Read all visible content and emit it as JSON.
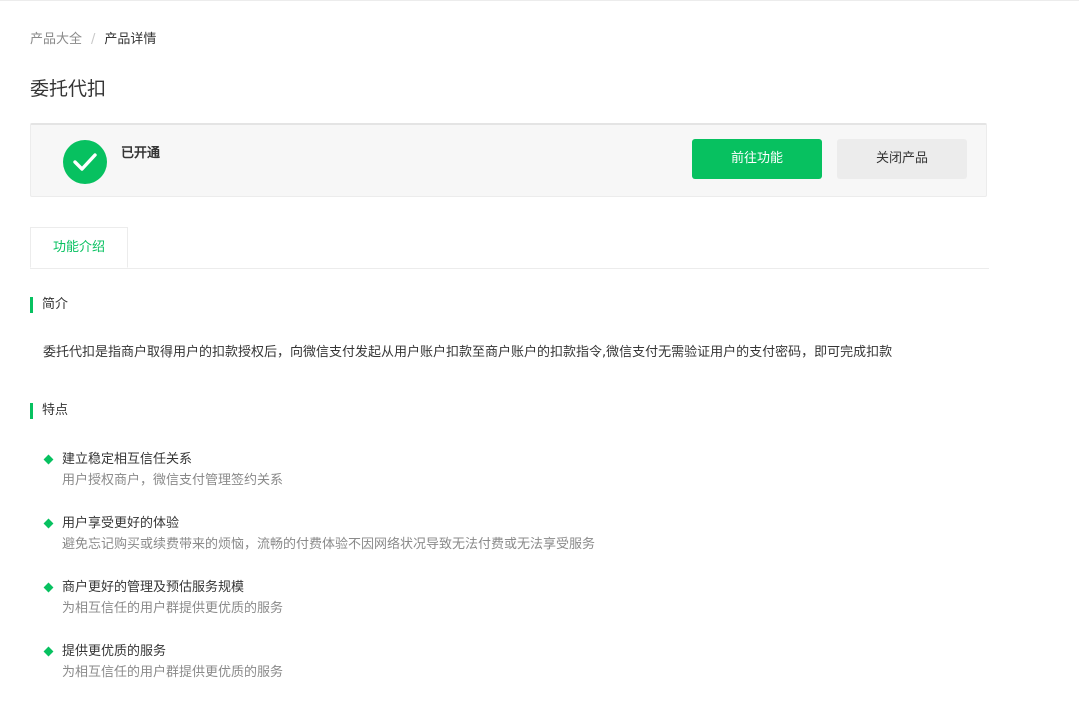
{
  "breadcrumb": {
    "parent": "产品大全",
    "separator": "/",
    "current": "产品详情"
  },
  "page": {
    "title": "委托代扣"
  },
  "status": {
    "label": "已开通",
    "primary_button": "前往功能",
    "secondary_button": "关闭产品",
    "icon": "check-circle-icon",
    "accent_color": "#07c160"
  },
  "tabs": [
    {
      "label": "功能介绍",
      "active": true
    }
  ],
  "sections": {
    "intro": {
      "title": "简介",
      "text": "委托代扣是指商户取得用户的扣款授权后，向微信支付发起从用户账户扣款至商户账户的扣款指令,微信支付无需验证用户的支付密码，即可完成扣款"
    },
    "features": {
      "title": "特点",
      "items": [
        {
          "title": "建立稳定相互信任关系",
          "desc": "用户授权商户，微信支付管理签约关系"
        },
        {
          "title": "用户享受更好的体验",
          "desc": "避免忘记购买或续费带来的烦恼，流畅的付费体验不因网络状况导致无法付费或无法享受服务"
        },
        {
          "title": "商户更好的管理及预估服务规模",
          "desc": "为相互信任的用户群提供更优质的服务"
        },
        {
          "title": "提供更优质的服务",
          "desc": "为相互信任的用户群提供更优质的服务"
        }
      ]
    }
  }
}
